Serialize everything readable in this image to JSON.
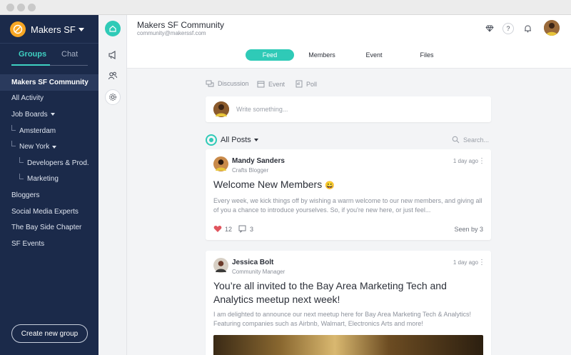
{
  "window": {
    "traffic_lights": [
      "close",
      "minimize",
      "zoom"
    ]
  },
  "sidebar": {
    "brand": "Makers SF",
    "tabs": [
      {
        "label": "Groups",
        "active": true
      },
      {
        "label": "Chat",
        "active": false
      }
    ],
    "items": [
      {
        "label": "Makers SF Community",
        "active": true
      },
      {
        "label": "All Activity"
      },
      {
        "label": "Job Boards",
        "expandable": true
      },
      {
        "label": "Amsterdam"
      },
      {
        "label": "New York",
        "expandable": true
      },
      {
        "label": "Developers & Prod."
      },
      {
        "label": "Marketing"
      },
      {
        "label": "Bloggers"
      },
      {
        "label": "Social Media Experts"
      },
      {
        "label": "The Bay Side Chapter"
      },
      {
        "label": "SF Events"
      }
    ],
    "create_button": "Create new group"
  },
  "rail": {
    "icons": [
      "home-icon",
      "megaphone-icon",
      "people-icon",
      "gear-icon"
    ]
  },
  "header": {
    "title": "Makers SF Community",
    "email": "community@makerssf.com",
    "tabs": [
      {
        "label": "Feed",
        "active": true
      },
      {
        "label": "Members"
      },
      {
        "label": "Event"
      },
      {
        "label": "Files"
      }
    ],
    "help_label": "?"
  },
  "composer": {
    "tabs": [
      "Discussion",
      "Event",
      "Poll"
    ],
    "placeholder": "Write something..."
  },
  "feed": {
    "filter": "All Posts",
    "search_placeholder": "Search..."
  },
  "posts": [
    {
      "author": "Mandy Sanders",
      "role": "Crafts Blogger",
      "time": "1 day ago",
      "title": "Welcome New Members",
      "emoji": "😀",
      "body": "Every week, we kick things off by wishing a warm welcome to our new members, and giving all of you a chance to introduce yourselves. So, if you're new here, or just feel...",
      "likes": "12",
      "comments": "3",
      "seen": "Seen by 3"
    },
    {
      "author": "Jessica Bolt",
      "role": "Community Manager",
      "time": "1 day ago",
      "title": "You’re all invited to the Bay Area Marketing Tech and Analytics meetup next week!",
      "body": "I am delighted to announce our next meetup here for Bay Area Marketing Tech & Analytics! Featuring companies such as Airbnb, Walmart, Electronics Arts and more!"
    }
  ],
  "colors": {
    "accent": "#2fcab7",
    "sidebar": "#1b2a4a",
    "brand": "#f6a623",
    "like": "#e0555e"
  }
}
